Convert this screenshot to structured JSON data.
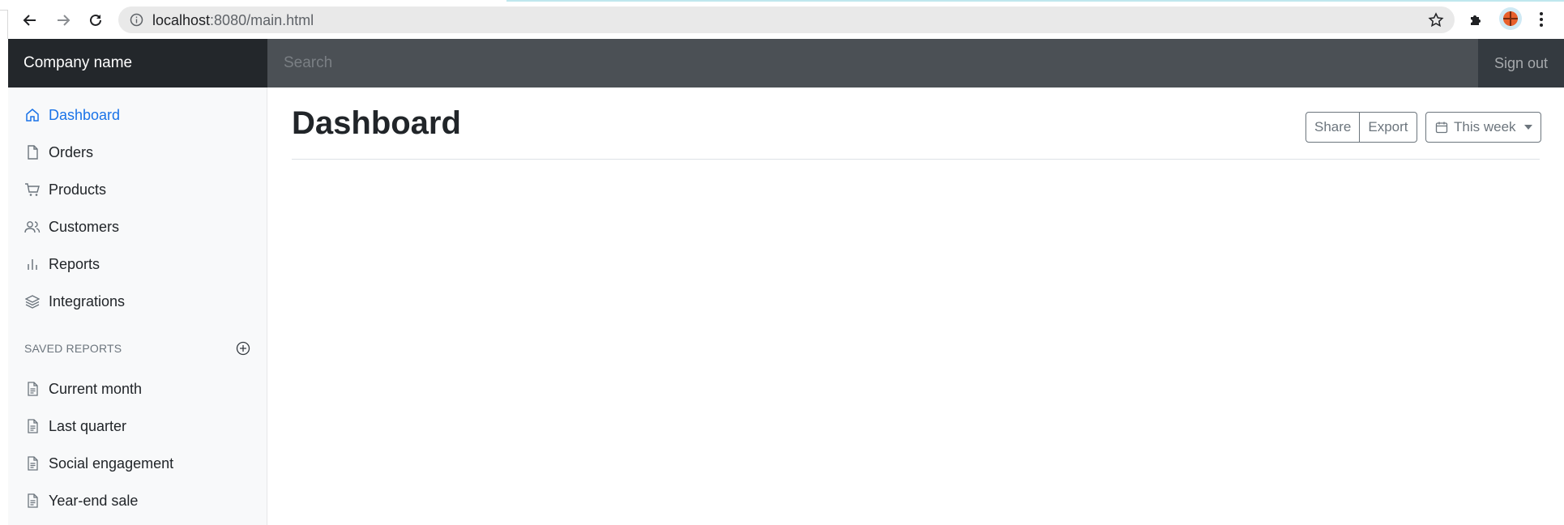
{
  "browser": {
    "url_host": "localhost",
    "url_rest": ":8080/main.html"
  },
  "header": {
    "brand": "Company name",
    "search_placeholder": "Search",
    "signout": "Sign out"
  },
  "sidebar": {
    "items": [
      {
        "label": "Dashboard",
        "icon": "home-icon",
        "active": true
      },
      {
        "label": "Orders",
        "icon": "file-icon"
      },
      {
        "label": "Products",
        "icon": "shopping-cart-icon"
      },
      {
        "label": "Customers",
        "icon": "users-icon"
      },
      {
        "label": "Reports",
        "icon": "bar-chart-icon"
      },
      {
        "label": "Integrations",
        "icon": "layers-icon"
      }
    ],
    "saved_reports_heading": "SAVED REPORTS",
    "saved_reports": [
      {
        "label": "Current month",
        "icon": "file-text-icon"
      },
      {
        "label": "Last quarter",
        "icon": "file-text-icon"
      },
      {
        "label": "Social engagement",
        "icon": "file-text-icon"
      },
      {
        "label": "Year-end sale",
        "icon": "file-text-icon"
      }
    ]
  },
  "main": {
    "title": "Dashboard",
    "share_label": "Share",
    "export_label": "Export",
    "period_label": "This week"
  },
  "colors": {
    "topbar": "#343a40",
    "brand_bg": "#23272b",
    "active_link": "#1a73e8"
  }
}
